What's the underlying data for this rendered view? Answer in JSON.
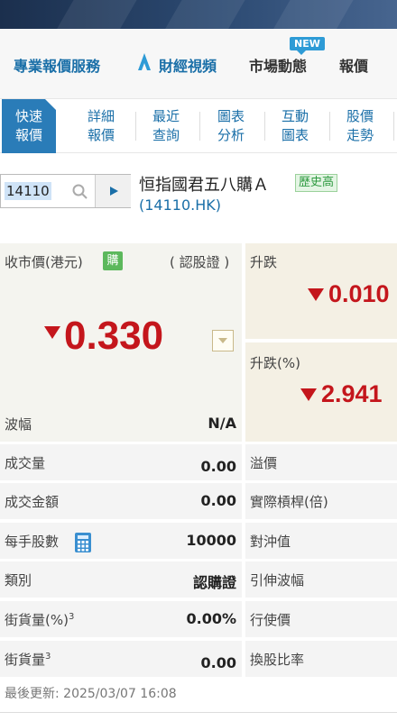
{
  "topnav": {
    "items": [
      "專業報價服務",
      "財經視頻",
      "市場動態",
      "報價"
    ],
    "new_badge": "NEW"
  },
  "subtabs": [
    {
      "line1": "快速",
      "line2": "報價"
    },
    {
      "line1": "詳細",
      "line2": "報價"
    },
    {
      "line1": "最近",
      "line2": "查詢"
    },
    {
      "line1": "圖表",
      "line2": "分析"
    },
    {
      "line1": "互動",
      "line2": "圖表"
    },
    {
      "line1": "股價",
      "line2": "走勢"
    }
  ],
  "search": {
    "value": "14110"
  },
  "stock": {
    "name": "恒指國君五八購Ａ",
    "hist_badge": "歷史高",
    "code": "(14110.HK)"
  },
  "quote": {
    "close_label": "收市價(港元)",
    "buy_badge": "購",
    "type_label": "( 認股證 )",
    "price": "0.330",
    "change_label": "升跌",
    "change_value": "0.010",
    "pct_label": "升跌(%)",
    "pct_value": "2.941",
    "range_label": "波幅",
    "range_value": "N/A"
  },
  "rows": {
    "volume_label": "成交量",
    "volume_value": "0.00",
    "turnover_label": "成交金額",
    "turnover_value": "0.00",
    "lot_label": "每手股數",
    "lot_value": "10000",
    "category_label": "類別",
    "category_value": "認購證",
    "outstanding_pct_label": "街貨量(%)",
    "outstanding_pct_value": "0.00%",
    "outstanding_label": "街貨量",
    "outstanding_value": "0.00",
    "sup": "3",
    "premium_label": "溢價",
    "gearing_label": "實際槓桿(倍)",
    "hedge_label": "對沖值",
    "iv_label": "引伸波幅",
    "strike_label": "行使價",
    "ratio_label": "換股比率"
  },
  "last_updated": "最後更新: 2025/03/07 16:08",
  "colors": {
    "accent": "#1a6fa8",
    "down": "#c4161c",
    "active_tab": "#2a7cb8"
  }
}
